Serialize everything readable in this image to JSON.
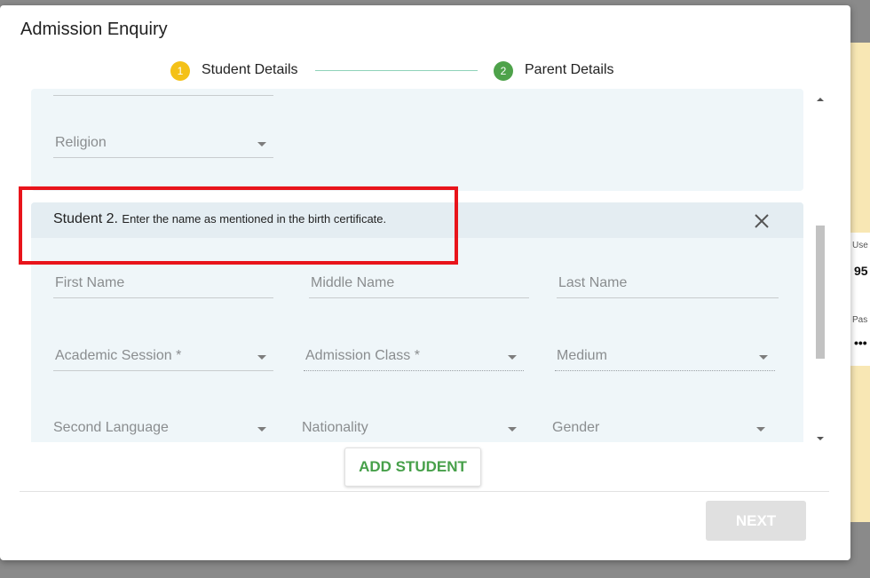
{
  "dialog": {
    "title": "Admission Enquiry"
  },
  "stepper": {
    "steps": [
      {
        "number": "1",
        "label": "Student Details",
        "color": "#f4c117"
      },
      {
        "number": "2",
        "label": "Parent Details",
        "color": "#4ea24a"
      }
    ]
  },
  "student1": {
    "religion_label": "Religion"
  },
  "student2": {
    "title": "Student 2.",
    "note": "Enter the name as mentioned in the birth certificate.",
    "fields": {
      "first_name": "First Name",
      "middle_name": "Middle Name",
      "last_name": "Last Name",
      "academic_session": "Academic Session *",
      "admission_class": "Admission Class *",
      "medium": "Medium",
      "second_language": "Second Language",
      "nationality": "Nationality",
      "gender": "Gender"
    }
  },
  "buttons": {
    "add_student": "ADD STUDENT",
    "next": "NEXT"
  },
  "background_page": {
    "user_label": "Use",
    "user_value": "95",
    "pass_label": "Pas",
    "pass_value": "•••"
  },
  "colors": {
    "accent_green": "#47a04a",
    "highlight_red": "#e8141b",
    "card_bg": "#eff6f9"
  }
}
